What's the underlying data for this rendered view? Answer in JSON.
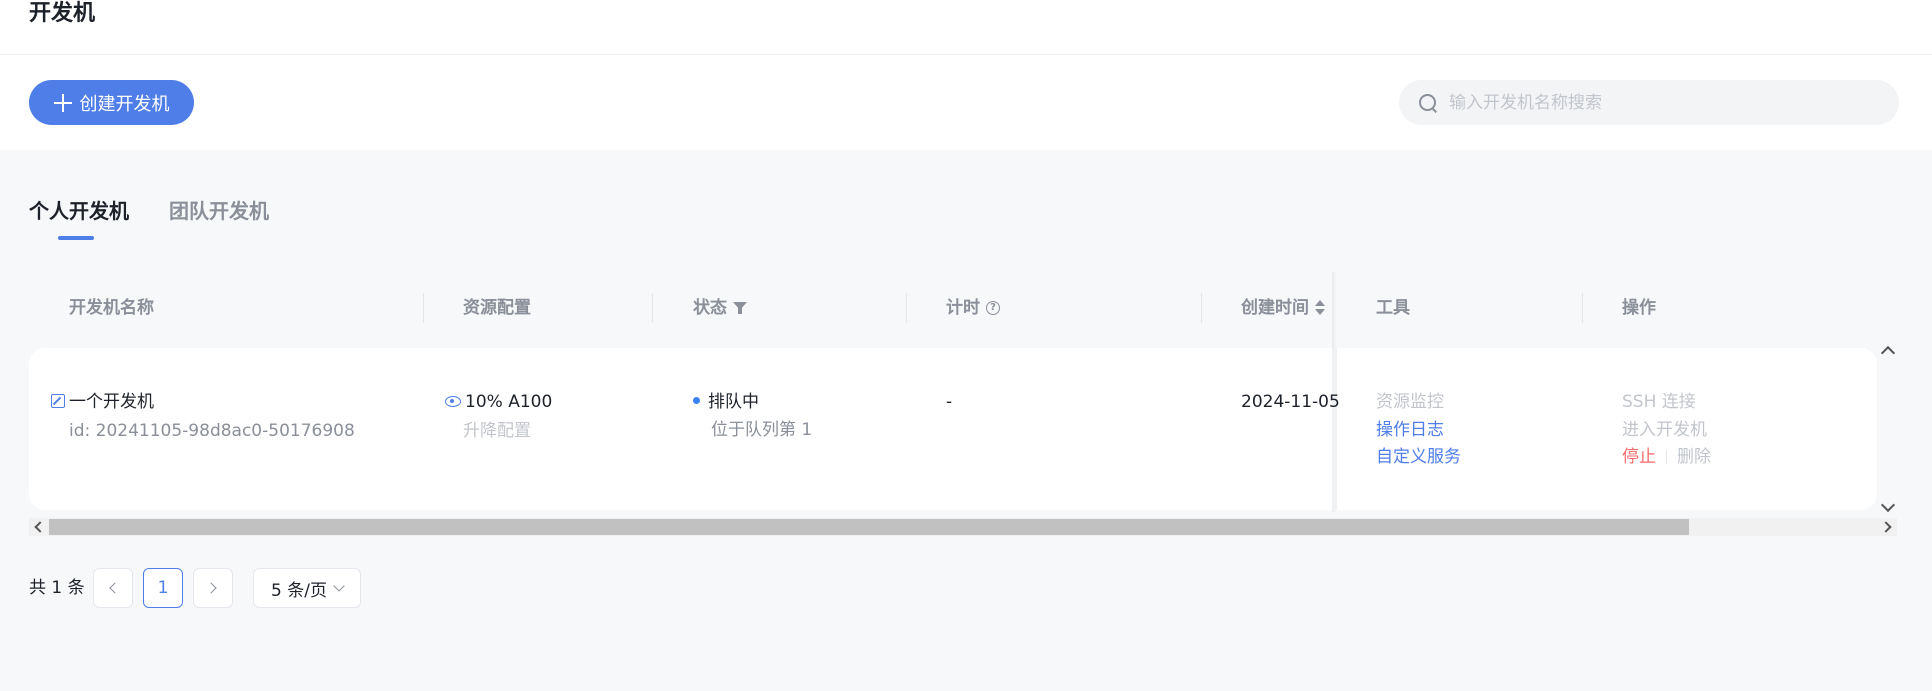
{
  "page": {
    "title": "开发机"
  },
  "toolbar": {
    "create_label": "创建开发机"
  },
  "search": {
    "placeholder": "输入开发机名称搜索"
  },
  "tabs": [
    {
      "label": "个人开发机",
      "active": true
    },
    {
      "label": "团队开发机",
      "active": false
    }
  ],
  "table": {
    "columns": {
      "name": "开发机名称",
      "resource": "资源配置",
      "status": "状态",
      "timer": "计时",
      "created": "创建时间",
      "tools": "工具",
      "actions": "操作"
    },
    "rows": [
      {
        "name": "一个开发机",
        "id": "id: 20241105-98d8ac0-50176908",
        "resource": "10% A100",
        "resource_action": "升降配置",
        "status": "排队中",
        "status_detail": "位于队列第 1",
        "timer": "-",
        "created": "2024-11-05",
        "tools": {
          "monitor": "资源监控",
          "log": "操作日志",
          "custom": "自定义服务"
        },
        "actions": {
          "ssh": "SSH 连接",
          "enter": "进入开发机",
          "stop": "停止",
          "delete": "删除"
        }
      }
    ]
  },
  "pagination": {
    "total": "共 1 条",
    "current": "1",
    "page_size": "5 条/页"
  },
  "colors": {
    "accent": "#4f7ee8",
    "danger": "#f56c6c",
    "status_dot": "#3b82f6"
  }
}
